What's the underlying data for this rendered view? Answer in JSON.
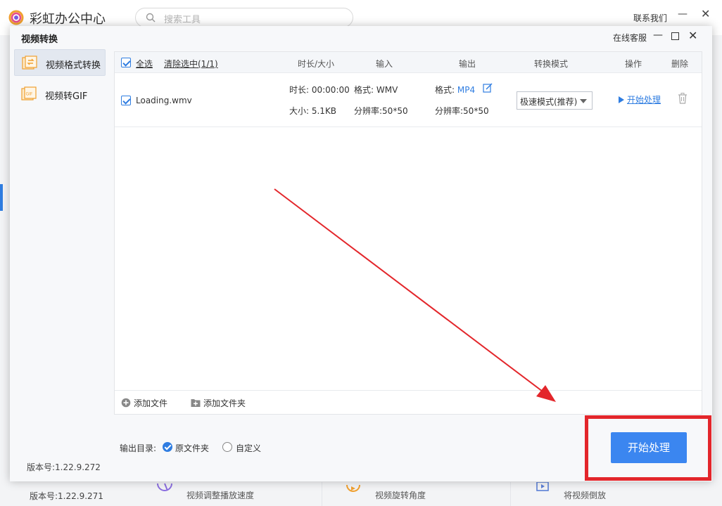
{
  "background_app": {
    "title": "彩虹办公中心",
    "search_placeholder": "搜索工具",
    "contact_label": "联系我们",
    "version": "版本号:1.22.9.271",
    "tools": [
      {
        "label": "视频调整播放速度",
        "icon": "speed-icon"
      },
      {
        "label": "视频旋转角度",
        "icon": "rotate-icon"
      },
      {
        "label": "将视频倒放",
        "icon": "reverse-play-icon"
      }
    ]
  },
  "dialog": {
    "title": "视频转换",
    "online_service": "在线客服",
    "sidebar": {
      "items": [
        {
          "label": "视频格式转换",
          "active": true,
          "icon": "video-convert-icon"
        },
        {
          "label": "视频转GIF",
          "active": false,
          "icon": "gif-icon"
        }
      ],
      "version": "版本号:1.22.9.272"
    },
    "table": {
      "select_all": "全选",
      "clear_selection": "清除选中(1/1)",
      "columns": {
        "duration_size": "时长/大小",
        "input": "输入",
        "output": "输出",
        "mode": "转换模式",
        "action": "操作",
        "delete": "删除"
      },
      "rows": [
        {
          "filename": "Loading.wmv",
          "duration": "时长: 00:00:00",
          "size": "大小: 5.1KB",
          "input_format_label": "格式:",
          "input_format": "WMV",
          "input_resolution": "分辨率:50*50",
          "output_format_label": "格式:",
          "output_format": "MP4",
          "output_resolution": "分辨率:50*50",
          "mode": "极速模式(推荐)",
          "action": "开始处理"
        }
      ]
    },
    "footer": {
      "add_file": "添加文件",
      "add_folder": "添加文件夹"
    },
    "output_dir": {
      "label": "输出目录:",
      "options": [
        {
          "label": "原文件夹",
          "selected": true
        },
        {
          "label": "自定义",
          "selected": false
        }
      ]
    },
    "start_button": "开始处理"
  },
  "colors": {
    "accent": "#2f7de1",
    "button": "#3b86f0",
    "annotation": "#e3262b"
  }
}
